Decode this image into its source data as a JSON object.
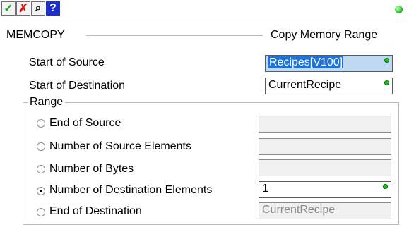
{
  "toolbar": {
    "ok_icon": "check-icon",
    "cancel_icon": "x-icon",
    "lookup_icon": "tag-browser-icon",
    "help_icon": "question-icon",
    "ok_glyph": "✓",
    "cancel_glyph": "✗",
    "lookup_glyph": "⌕",
    "help_glyph": "?"
  },
  "header": {
    "instruction": "MEMCOPY",
    "description": "Copy Memory Range"
  },
  "source": {
    "label": "Start of Source",
    "value": "Recipes[V100]"
  },
  "destination": {
    "label": "Start of Destination",
    "value": "CurrentRecipe"
  },
  "range": {
    "title": "Range",
    "options": [
      {
        "label": "End of Source",
        "checked": false,
        "value": ""
      },
      {
        "label": "Number of Source Elements",
        "checked": false,
        "value": ""
      },
      {
        "label": "Number of Bytes",
        "checked": false,
        "value": ""
      },
      {
        "label": "Number of Destination Elements",
        "checked": true,
        "value": "1"
      },
      {
        "label": "End of Destination",
        "checked": false,
        "value": "CurrentRecipe"
      }
    ]
  },
  "colors": {
    "status_led": "#2ac12a",
    "selection": "#1e73d8",
    "valid_dot": "#17c417"
  }
}
